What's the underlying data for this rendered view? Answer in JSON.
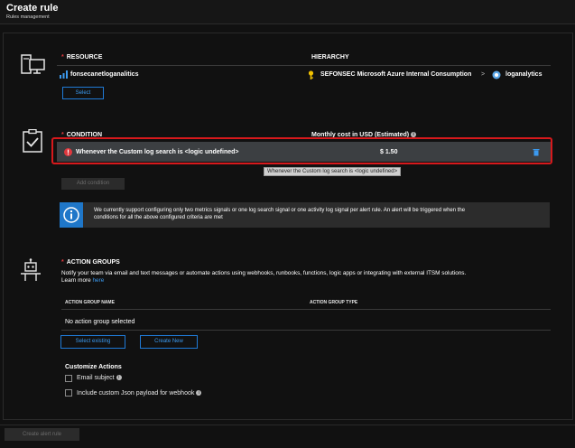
{
  "header": {
    "title": "Create rule",
    "subtitle": "Rules management"
  },
  "resource": {
    "heading": "RESOURCE",
    "name": "fonsecanetloganalitics",
    "select_label": "Select",
    "hierarchy_heading": "HIERARCHY",
    "subscription": "SEFONSEC Microsoft Azure Internal Consumption",
    "separator": ">",
    "workspace": "loganalytics"
  },
  "condition": {
    "heading": "CONDITION",
    "cost_heading": "Monthly cost in USD (Estimated)",
    "row_text": "Whenever the Custom log search is <logic undefined>",
    "row_cost": "$ 1.50",
    "tooltip": "Whenever the  Custom log search is <logic undefined>",
    "add_label": "Add condition",
    "info_text_1": "We currently support configuring only two metrics signals or one log search signal or one activity log signal per alert rule. An alert will be triggered when the",
    "info_text_2": "conditions for all the above configured criteria are met"
  },
  "action_groups": {
    "heading": "ACTION GROUPS",
    "description": "Notify your team via email and text messages or automate actions using webhooks, runbooks, functions, logic apps or integrating with external ITSM solutions.",
    "learn_more": "Learn more",
    "here": "here",
    "col_name": "ACTION GROUP NAME",
    "col_type": "ACTION GROUP TYPE",
    "empty_row": "No action group selected",
    "select_existing": "Select existing",
    "create_new": "Create New",
    "customize_heading": "Customize Actions",
    "email_subject": "Email subject",
    "custom_json": "Include custom Json payload for webhook"
  },
  "footer": {
    "create_label": "Create alert rule"
  },
  "colors": {
    "accent": "#1f7ad6",
    "danger": "#d7191c",
    "key": "#f2c200"
  }
}
